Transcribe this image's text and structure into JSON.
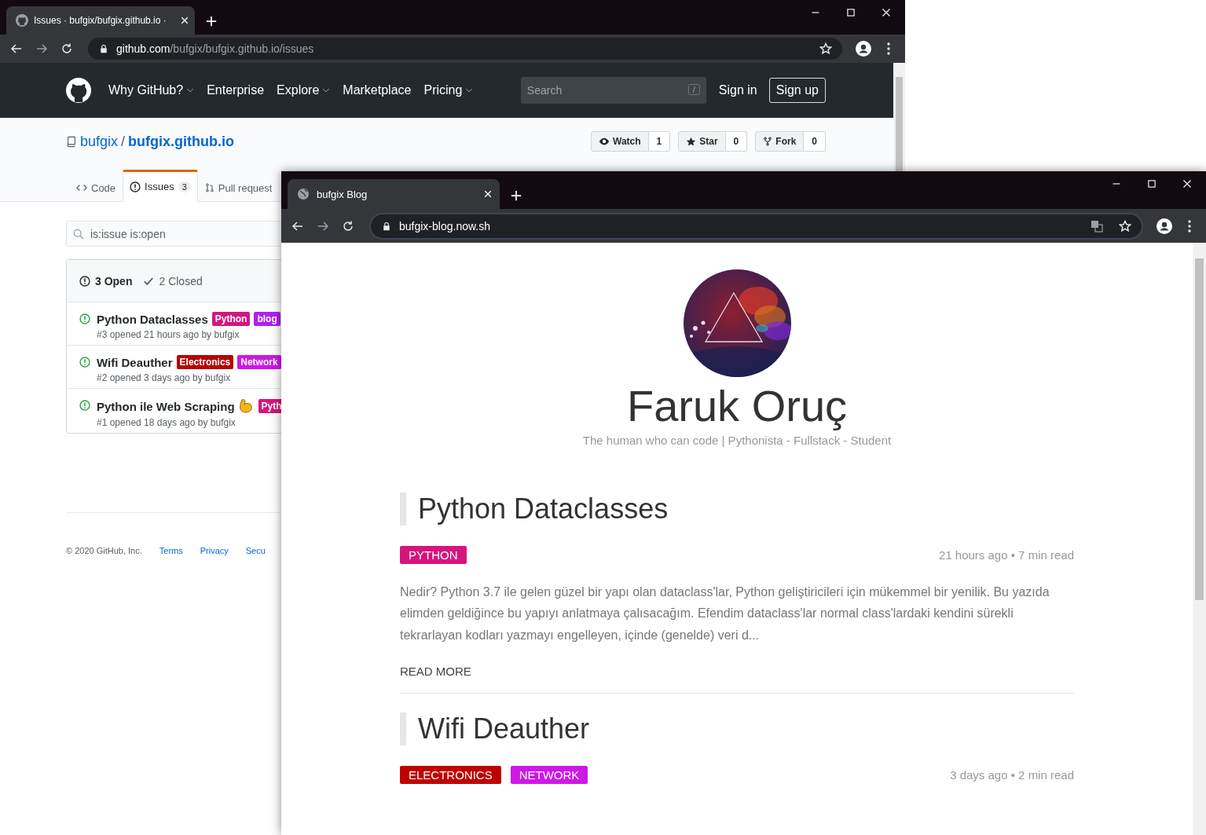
{
  "github_window": {
    "tab_title": "Issues · bufgix/bufgix.github.io ·",
    "url_host": "github.com",
    "url_path": "/bufgix/bufgix.github.io/issues",
    "nav": [
      {
        "label": "Why GitHub?",
        "dropdown": true
      },
      {
        "label": "Enterprise",
        "dropdown": false
      },
      {
        "label": "Explore",
        "dropdown": true
      },
      {
        "label": "Marketplace",
        "dropdown": false
      },
      {
        "label": "Pricing",
        "dropdown": true
      }
    ],
    "search": {
      "placeholder": "Search",
      "shortcut": "/"
    },
    "sign_in": "Sign in",
    "sign_up": "Sign up",
    "repo": {
      "owner": "bufgix",
      "separator": "/",
      "name": "bufgix.github.io"
    },
    "repo_actions": [
      {
        "label": "Watch",
        "count": "1"
      },
      {
        "label": "Star",
        "count": "0"
      },
      {
        "label": "Fork",
        "count": "0"
      }
    ],
    "tabs": [
      {
        "label": "Code",
        "selected": false
      },
      {
        "label": "Issues",
        "count": "3",
        "selected": true
      },
      {
        "label": "Pull request",
        "selected": false
      }
    ],
    "filter": {
      "value": "is:issue is:open"
    },
    "states": [
      {
        "label": "3 Open",
        "selected": true
      },
      {
        "label": "2 Closed",
        "selected": false
      }
    ],
    "issues": [
      {
        "title": "Python Dataclasses",
        "emoji": false,
        "labels": [
          {
            "text": "Python",
            "color": "#d6157c"
          },
          {
            "text": "blog",
            "color": "#b01ff0"
          }
        ],
        "meta": "#3 opened 21 hours ago by bufgix"
      },
      {
        "title": "Wifi Deauther",
        "emoji": false,
        "labels": [
          {
            "text": "Electronics",
            "color": "#b60205"
          },
          {
            "text": "Network",
            "color": "#cc17e6"
          }
        ],
        "meta": "#2 opened 3 days ago by bufgix"
      },
      {
        "title": "Python ile Web Scraping",
        "emoji": true,
        "labels": [
          {
            "text": "Pyth",
            "color": "#d6157c"
          }
        ],
        "meta": "#1 opened 18 days ago by bufgix"
      }
    ],
    "footer": {
      "copyright": "© 2020 GitHub, Inc.",
      "links": [
        "Terms",
        "Privacy",
        "Secu"
      ]
    }
  },
  "blog_window": {
    "tab_title": "bufgix Blog",
    "url": "bufgix-blog.now.sh",
    "profile": {
      "name": "Faruk Oruç",
      "tagline": "The human who can code | Pythonista - Fullstack - Student"
    },
    "posts": [
      {
        "title": "Python Dataclasses",
        "tags": [
          {
            "text": "PYTHON",
            "color": "#d6157c"
          }
        ],
        "meta": "21 hours ago • 7 min read",
        "excerpt": "Nedir? Python 3.7 ile gelen güzel bir yapı olan dataclass'lar, Python geliştiricileri için mükemmel bir yenilik. Bu yazıda elimden geldiğince bu yapıyı anlatmaya çalısacağım. Efendim dataclass'lar normal class'lardaki kendini sürekli tekrarlayan kodları yazmayı engelleyen, içinde (genelde) veri d...",
        "read_more": "READ MORE"
      },
      {
        "title": "Wifi Deauther",
        "tags": [
          {
            "text": "ELECTRONICS",
            "color": "#c00000"
          },
          {
            "text": "NETWORK",
            "color": "#cf17e8"
          }
        ],
        "meta": "3 days ago • 2 min read"
      }
    ]
  }
}
